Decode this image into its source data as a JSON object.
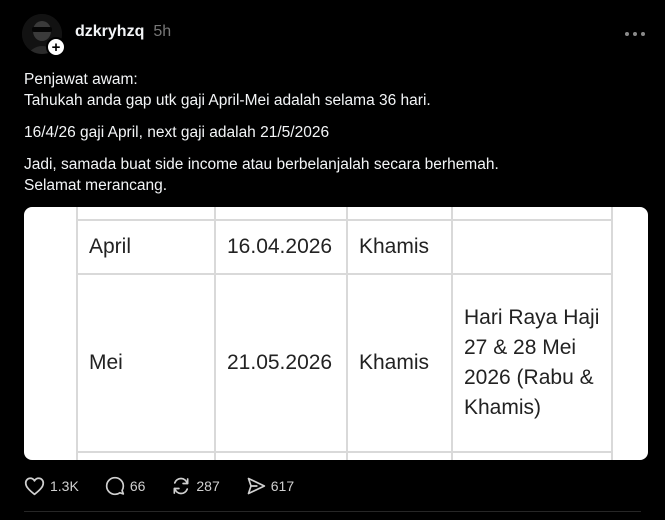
{
  "post": {
    "username": "dzkryhzq",
    "timestamp": "5h",
    "follow_symbol": "+",
    "paragraphs": [
      [
        "Penjawat awam:",
        "Tahukah anda gap utk gaji April-Mei adalah selama 36 hari."
      ],
      [
        "16/4/26 gaji April, next gaji adalah 21/5/2026"
      ],
      [
        "Jadi, samada buat side income atau berbelanjalah secara berhemah.",
        "Selamat merancang."
      ]
    ]
  },
  "table": {
    "rows": [
      {
        "month": "April",
        "date": "16.04.2026",
        "day": "Khamis",
        "note": ""
      },
      {
        "month": "Mei",
        "date": "21.05.2026",
        "day": "Khamis",
        "note": "Hari Raya Haji 27 & 28 Mei 2026 (Rabu & Khamis)"
      }
    ]
  },
  "actions": {
    "likes": "1.3K",
    "replies": "66",
    "reposts": "287",
    "shares": "617"
  },
  "icons": {
    "like": "heart-icon",
    "reply": "speech-bubble-icon",
    "repost": "repost-icon",
    "share": "send-icon",
    "more": "ellipsis-icon"
  }
}
